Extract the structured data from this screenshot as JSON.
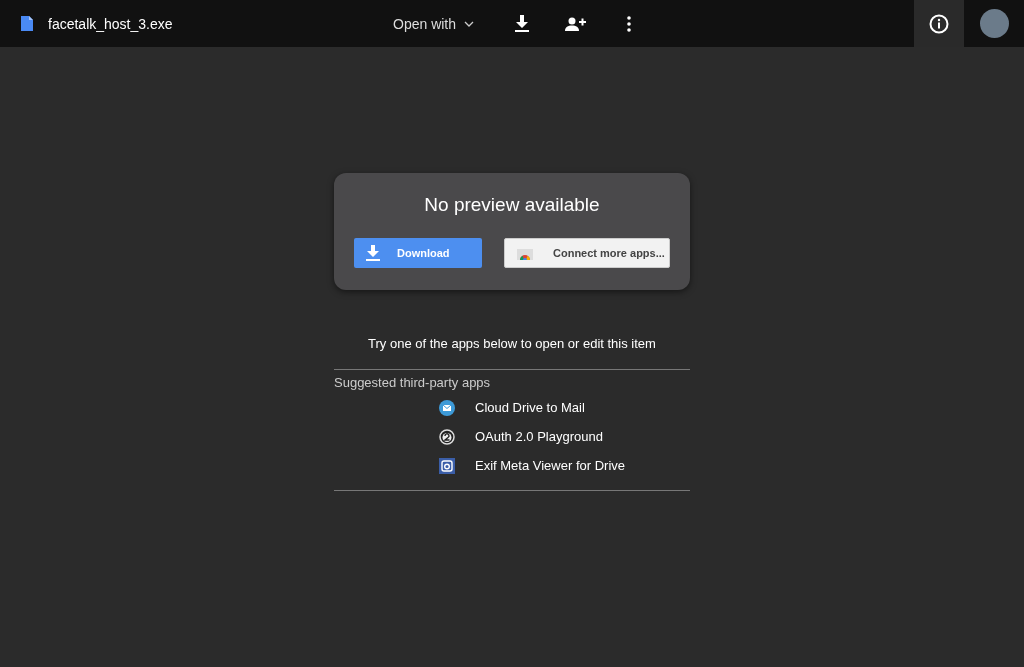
{
  "top_bar": {
    "file_name": "facetalk_host_3.exe",
    "open_with": "Open with"
  },
  "preview_card": {
    "title": "No preview available",
    "download_button": "Download",
    "connect_button": "Connect more apps..."
  },
  "suggestion": {
    "prompt": "Try one of the apps below to open or edit this item",
    "heading": "Suggested third-party apps",
    "apps": [
      {
        "name": "Cloud Drive to Mail",
        "kind": "mail"
      },
      {
        "name": "OAuth 2.0 Playground",
        "kind": "oauth"
      },
      {
        "name": "Exif Meta Viewer for Drive",
        "kind": "camera"
      }
    ]
  }
}
